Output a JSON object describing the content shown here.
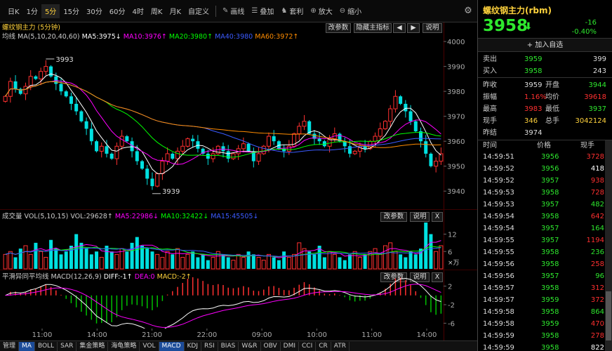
{
  "toolbar": {
    "periods": [
      "日K",
      "1分",
      "5分",
      "15分",
      "30分",
      "60分",
      "4时",
      "周K",
      "月K",
      "自定义"
    ],
    "active_period": "5分",
    "tools": [
      {
        "icon": "pen-icon",
        "label": "画线"
      },
      {
        "icon": "overlay-icon",
        "label": "叠加"
      },
      {
        "icon": "arbitrage-icon",
        "label": "套利"
      },
      {
        "icon": "zoom-in-icon",
        "label": "放大"
      },
      {
        "icon": "zoom-out-icon",
        "label": "缩小"
      }
    ]
  },
  "main_panel": {
    "title": "螺纹钢主力 (5分钟)",
    "ma_label": "均线 MA(5,10,20,40,60)",
    "ma5": "MA5:3975↓",
    "ma10": "MA10:3976↑",
    "ma20": "MA20:3980↑",
    "ma40": "MA40:3980",
    "ma60": "MA60:3972↑",
    "btn_params": "改参数",
    "btn_hide": "隐藏主指标",
    "btn_help": "说明",
    "y_ticks": [
      "4000",
      "3990",
      "3980",
      "3970",
      "3960",
      "3950",
      "3940"
    ],
    "high_label": "3993",
    "low_label": "3939"
  },
  "volume_panel": {
    "title": "成交量 VOL(5,10,15)",
    "vol": "VOL:29628↑",
    "ma5": "MA5:22986↓",
    "ma10": "MA10:32422↓",
    "ma15": "MA15:45505↓",
    "btn_params": "改参数",
    "btn_help": "说明",
    "btn_close": "X",
    "y_ticks": [
      "12",
      "6"
    ],
    "unit": "×万"
  },
  "macd_panel": {
    "title": "平滑异同平均线 MACD(12,26,9)",
    "diff": "DIFF:-1↑",
    "dea": "DEA:0",
    "macd": "MACD:-2↑",
    "btn_params": "改参数",
    "btn_help": "说明",
    "btn_close": "X",
    "y_ticks": [
      "2",
      "-2",
      "-6"
    ]
  },
  "x_axis": [
    "11:00",
    "14:00",
    "21:00",
    "22:00",
    "09:00",
    "10:00",
    "11:00",
    "14:00"
  ],
  "bottom_tabs": [
    "管理",
    "MA",
    "BOLL",
    "SAR",
    "集金策略",
    "海龟策略",
    "VOL",
    "MACD",
    "KDJ",
    "RSI",
    "BIAS",
    "W&R",
    "OBV",
    "DMI",
    "CCI",
    "CR",
    "ATR"
  ],
  "bottom_tabs_active": [
    "MA",
    "MACD"
  ],
  "quote": {
    "symbol": "螺纹钢主力(rbm)",
    "price": "3958",
    "change": "-16",
    "change_pct": "-0.40%",
    "add_favorite": "+ 加入自选",
    "sell_label": "卖出",
    "sell_price": "3959",
    "sell_vol": "399",
    "buy_label": "买入",
    "buy_price": "3958",
    "buy_vol": "243",
    "rows": [
      {
        "l1": "昨收",
        "v1": "3959",
        "l2": "开盘",
        "v2": "3944"
      },
      {
        "l1": "振幅",
        "v1": "1.16%",
        "l2": "均价",
        "v2": "39618"
      },
      {
        "l1": "最高",
        "v1": "3983",
        "l2": "最低",
        "v2": "3937"
      },
      {
        "l1": "现手",
        "v1": "346",
        "l2": "总手",
        "v2": "3042124"
      }
    ],
    "settle_label": "昨结",
    "settle_value": "3974"
  },
  "ticks_header": {
    "time": "时间",
    "price": "价格",
    "vol": "现手"
  },
  "ticks": [
    {
      "t": "14:59:51",
      "p": "3956",
      "v": "3728",
      "c": "red"
    },
    {
      "t": "14:59:52",
      "p": "3956",
      "v": "418",
      "c": "white"
    },
    {
      "t": "14:59:52",
      "p": "3957",
      "v": "938",
      "c": "red"
    },
    {
      "t": "14:59:53",
      "p": "3958",
      "v": "728",
      "c": "red"
    },
    {
      "t": "14:59:53",
      "p": "3957",
      "v": "482",
      "c": "green"
    },
    {
      "t": "14:59:54",
      "p": "3958",
      "v": "642",
      "c": "red"
    },
    {
      "t": "14:59:54",
      "p": "3957",
      "v": "164",
      "c": "green"
    },
    {
      "t": "14:59:55",
      "p": "3957",
      "v": "1194",
      "c": "red"
    },
    {
      "t": "14:59:55",
      "p": "3958",
      "v": "236",
      "c": "green"
    },
    {
      "t": "14:59:56",
      "p": "3958",
      "v": "258",
      "c": "red"
    },
    {
      "t": "14:59:56",
      "p": "3957",
      "v": "96",
      "c": "green"
    },
    {
      "t": "14:59:57",
      "p": "3958",
      "v": "312",
      "c": "red"
    },
    {
      "t": "14:59:57",
      "p": "3959",
      "v": "372",
      "c": "red"
    },
    {
      "t": "14:59:58",
      "p": "3958",
      "v": "864",
      "c": "green"
    },
    {
      "t": "14:59:58",
      "p": "3959",
      "v": "470",
      "c": "red"
    },
    {
      "t": "14:59:59",
      "p": "3958",
      "v": "278",
      "c": "red"
    },
    {
      "t": "14:59:59",
      "p": "3958",
      "v": "822",
      "c": "white"
    }
  ],
  "chart_data": {
    "type": "candlestick",
    "y_range": [
      3935,
      4002
    ],
    "candles_close": [
      3978,
      3984,
      3981,
      3979,
      3982,
      3986,
      3985,
      3988,
      3990,
      3986,
      3983,
      3980,
      3978,
      3975,
      3972,
      3968,
      3965,
      3960,
      3956,
      3958,
      3955,
      3953,
      3958,
      3962,
      3960,
      3956,
      3952,
      3949,
      3945,
      3942,
      3947,
      3952,
      3955,
      3953,
      3956,
      3958,
      3961,
      3960,
      3957,
      3955,
      3953,
      3955,
      3958,
      3956,
      3953,
      3955,
      3957,
      3959,
      3956,
      3952,
      3955,
      3958,
      3962,
      3960,
      3957,
      3956,
      3958,
      3963,
      3966,
      3968,
      3963,
      3961,
      3960,
      3958,
      3961,
      3963,
      3960,
      3958,
      3955,
      3956,
      3958,
      3957,
      3960,
      3962,
      3965,
      3968,
      3973,
      3978,
      3975,
      3972,
      3968,
      3964,
      3960,
      3955,
      3950,
      3952,
      3955
    ],
    "volume_unit": "万",
    "volume_y_range": [
      0,
      16
    ],
    "volumes": [
      5,
      6,
      4,
      7,
      8,
      5,
      9,
      6,
      4,
      10,
      7,
      5,
      6,
      8,
      12,
      9,
      7,
      5,
      6,
      4,
      8,
      6,
      5,
      7,
      6,
      9,
      11,
      8,
      7,
      6,
      5,
      4,
      6,
      5,
      7,
      4,
      5,
      6,
      4,
      5,
      3,
      4,
      6,
      5,
      4,
      3,
      5,
      4,
      6,
      5,
      4,
      3,
      5,
      4,
      3,
      6,
      4,
      5,
      9,
      7,
      6,
      5,
      8,
      4,
      6,
      5,
      4,
      3,
      5,
      6,
      4,
      5,
      6,
      7,
      5,
      8,
      9,
      6,
      5,
      4,
      6,
      5,
      7,
      16,
      12,
      6,
      8
    ],
    "macd_y_range": [
      -7,
      3
    ]
  },
  "colors": {
    "up": "#ff3030",
    "down": "#00e0e0",
    "ma5": "#ffffff",
    "ma10": "#ff00ff",
    "ma20": "#00ff00",
    "ma40": "#3b5bff",
    "ma60": "#ff8c00",
    "green": "#2ee82e",
    "red": "#ff3030",
    "yellow": "#ffd23c"
  }
}
